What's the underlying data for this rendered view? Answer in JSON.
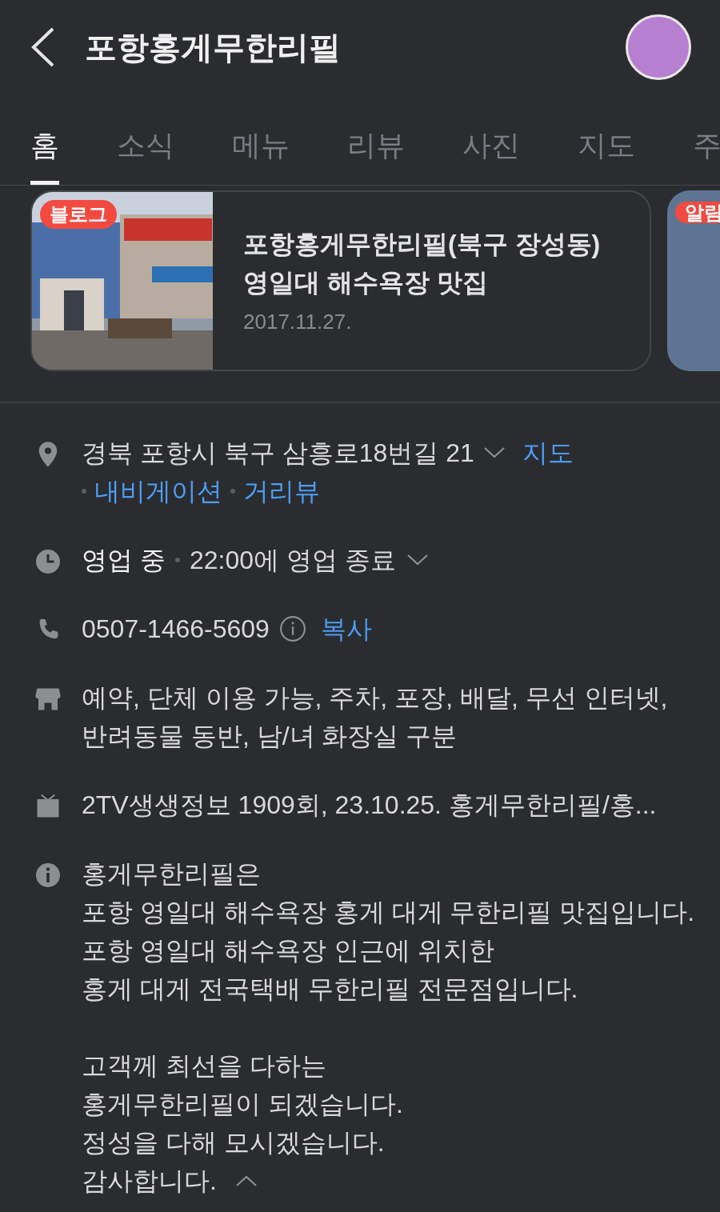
{
  "header": {
    "title": "포항홍게무한리필"
  },
  "tabs": [
    {
      "label": "홈",
      "selected": true
    },
    {
      "label": "소식",
      "selected": false
    },
    {
      "label": "메뉴",
      "selected": false
    },
    {
      "label": "리뷰",
      "selected": false
    },
    {
      "label": "사진",
      "selected": false
    },
    {
      "label": "지도",
      "selected": false
    },
    {
      "label": "주",
      "selected": false
    }
  ],
  "cards": [
    {
      "badge": "블로그",
      "title": "포항홍게무한리필(북구 장성동) 영일대 해수욕장 맛집",
      "date": "2017.11.27."
    },
    {
      "badge": "알림"
    }
  ],
  "address": {
    "text": "경북 포항시 북구 삼흥로18번길 21",
    "map_link": "지도",
    "links": [
      "내비게이션",
      "거리뷰"
    ]
  },
  "hours": {
    "status": "영업 중",
    "detail": "22:00에 영업 종료"
  },
  "phone": {
    "number": "0507-1466-5609",
    "copy": "복사"
  },
  "amenities": "예약, 단체 이용 가능, 주차, 포장, 배달, 무선 인터넷, 반려동물 동반, 남/녀 화장실 구분",
  "tv": "2TV생생정보 1909회, 23.10.25. 홍게무한리필/홍...",
  "description": [
    [
      "홍게무한리필은",
      "포항 영일대 해수욕장 홍게 대게 무한리필 맛집입니다.",
      "포항 영일대 해수욕장 인근에 위치한",
      "홍게 대게 전국택배 무한리필 전문점입니다."
    ],
    [
      "고객께 최선을 다하는",
      "홍게무한리필이 되겠습니다.",
      "정성을 다해 모시겠습니다.",
      "감사합니다."
    ]
  ]
}
